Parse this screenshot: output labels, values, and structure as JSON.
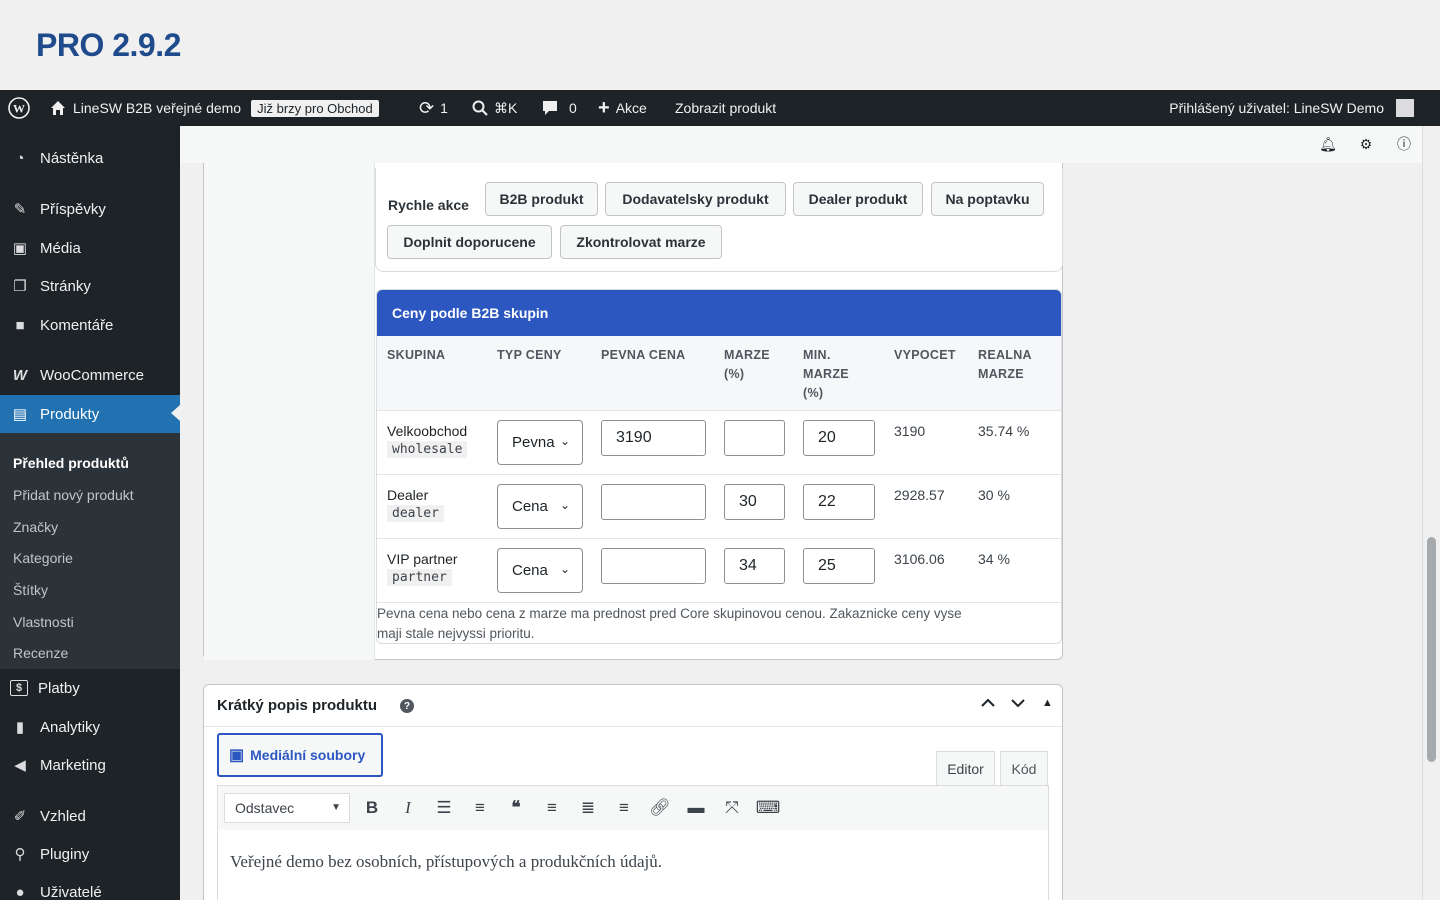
{
  "banner": {
    "version": "PRO 2.9.2"
  },
  "adminbar": {
    "site_name": "LineSW B2B veřejné demo",
    "badge": "Již brzy pro Obchod",
    "updates_count": "1",
    "search_shortcut": "⌘K",
    "comments_count": "0",
    "new_label": "Akce",
    "view_product": "Zobrazit produkt",
    "user_greeting": "Přihlášený uživatel: LineSW Demo"
  },
  "sidebar": {
    "items": [
      {
        "label": "Nástěnka",
        "icon": "dashboard-icon"
      },
      {
        "label": "Příspěvky",
        "icon": "pin-icon"
      },
      {
        "label": "Média",
        "icon": "media-icon"
      },
      {
        "label": "Stránky",
        "icon": "pages-icon"
      },
      {
        "label": "Komentáře",
        "icon": "comment-icon"
      },
      {
        "label": "WooCommerce",
        "icon": "woocommerce-icon"
      },
      {
        "label": "Produkty",
        "icon": "products-icon"
      },
      {
        "label": "Platby",
        "icon": "payments-icon"
      },
      {
        "label": "Analytiky",
        "icon": "analytics-icon"
      },
      {
        "label": "Marketing",
        "icon": "megaphone-icon"
      },
      {
        "label": "Vzhled",
        "icon": "brush-icon"
      },
      {
        "label": "Pluginy",
        "icon": "plugin-icon"
      },
      {
        "label": "Uživatelé",
        "icon": "user-icon"
      }
    ],
    "submenu": [
      "Přehled produktů",
      "Přidat nový produkt",
      "Značky",
      "Kategorie",
      "Štítky",
      "Vlastnosti",
      "Recenze"
    ]
  },
  "quick_actions": {
    "label": "Rychle akce",
    "buttons": [
      "B2B produkt",
      "Dodavatelsky produkt",
      "Dealer produkt",
      "Na poptavku",
      "Doplnit doporucene",
      "Zkontrolovat marze"
    ]
  },
  "b2b_prices": {
    "title": "Ceny podle B2B skupin",
    "columns": {
      "group": "SKUPINA",
      "price_type": "TYP CENY",
      "fixed_price": "PEVNA CENA",
      "margin_1": "MARZE",
      "margin_2": "(%)",
      "min_1": "MIN.",
      "min_2": "MARZE",
      "min_3": "(%)",
      "calc": "VYPOCET",
      "real_1": "REALNA",
      "real_2": "MARZE"
    },
    "rows": [
      {
        "name": "Velkoobchod",
        "slug": "wholesale",
        "type": "Pevna",
        "fixed": "3190",
        "margin": "",
        "min": "20",
        "calc": "3190",
        "real": "35.74 %"
      },
      {
        "name": "Dealer",
        "slug": "dealer",
        "type": "Cena",
        "fixed": "",
        "margin": "30",
        "min": "22",
        "calc": "2928.57",
        "real": "30 %"
      },
      {
        "name": "VIP partner",
        "slug": "partner",
        "type": "Cena",
        "fixed": "",
        "margin": "34",
        "min": "25",
        "calc": "3106.06",
        "real": "34 %"
      }
    ],
    "note_1": "Pevna cena nebo cena z marze ma prednost pred Core skupinovou cenou. Zakaznicke ceny vyse",
    "note_2": "maji stale nejvyssi prioritu."
  },
  "short_description": {
    "title": "Krátký popis produktu",
    "help": "?",
    "media_button": "Mediální soubory",
    "tab_editor": "Editor",
    "tab_code": "Kód",
    "format": "Odstavec",
    "content": "Veřejné demo bez osobních, přístupových a produkčních údajů."
  }
}
